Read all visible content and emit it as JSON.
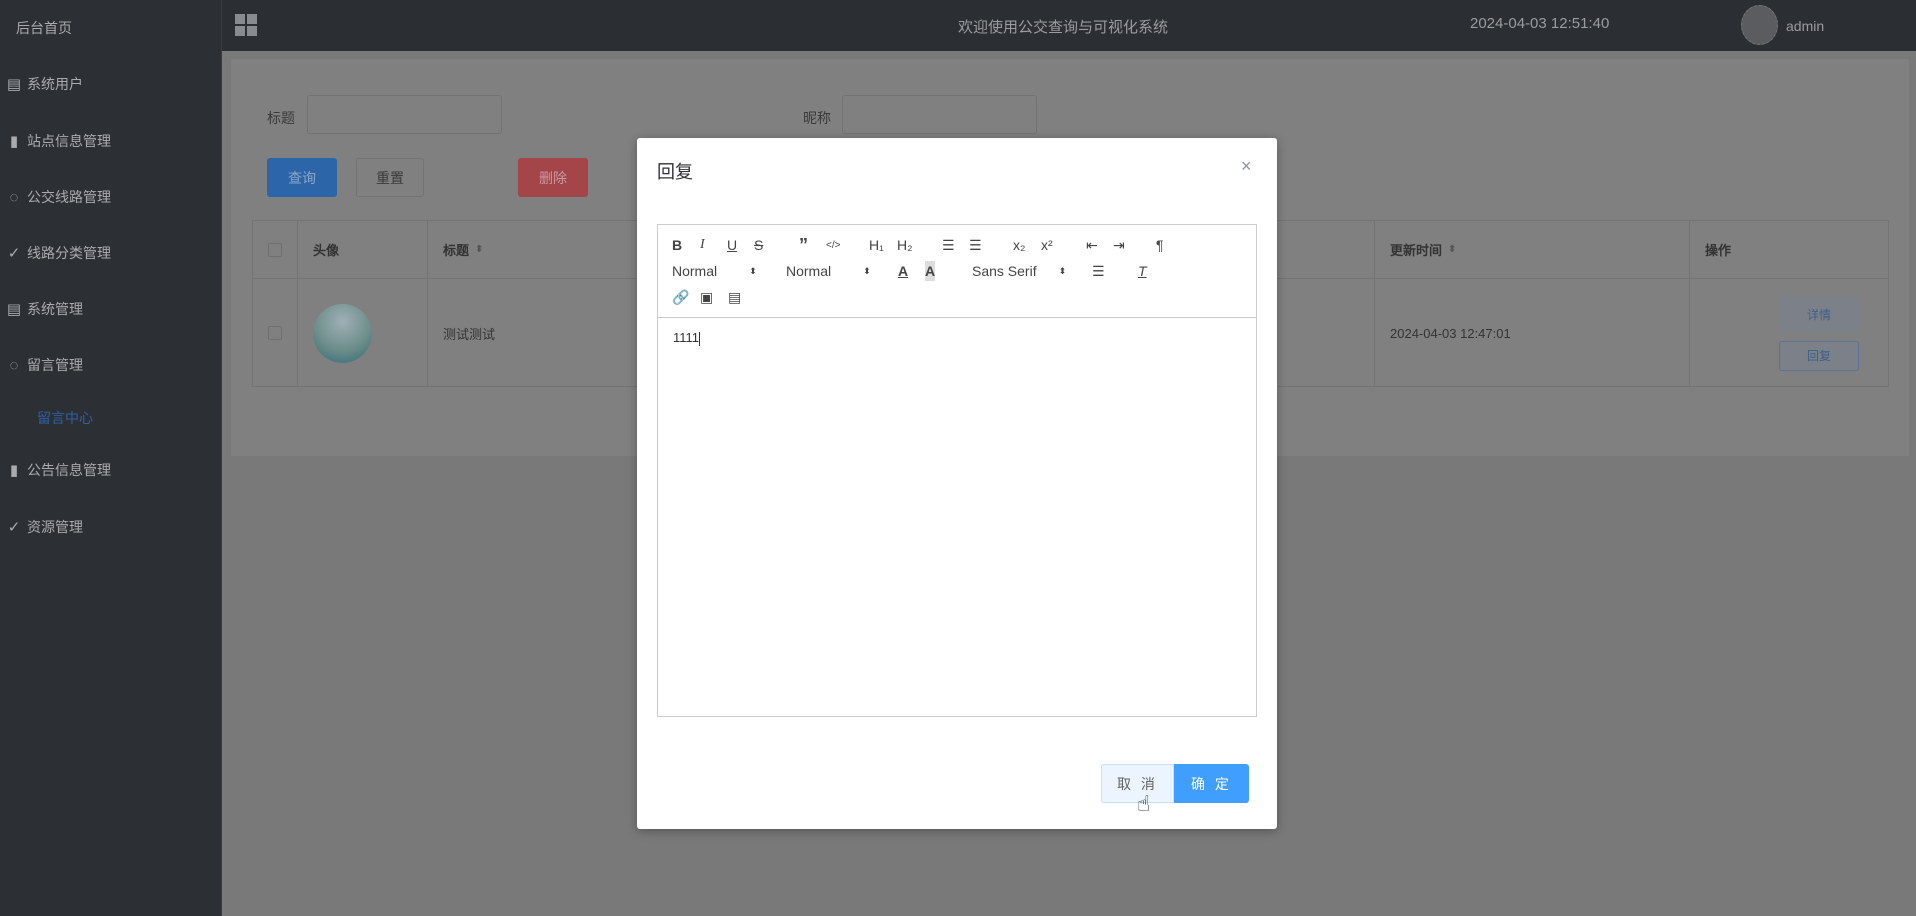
{
  "sidebar": {
    "home": "后台首页",
    "items": [
      {
        "label": "系统用户",
        "icon": "document-icon"
      },
      {
        "label": "站点信息管理",
        "icon": "bar-chart-icon"
      },
      {
        "label": "公交线路管理",
        "icon": "chat-icon"
      },
      {
        "label": "线路分类管理",
        "icon": "check-circle-icon"
      },
      {
        "label": "系统管理",
        "icon": "document-icon"
      },
      {
        "label": "留言管理",
        "icon": "chat-icon"
      },
      {
        "label": "公告信息管理",
        "icon": "bar-chart-icon"
      },
      {
        "label": "资源管理",
        "icon": "check-circle-icon"
      }
    ],
    "sub_item": "留言中心"
  },
  "header": {
    "title": "欢迎使用公交查询与可视化系统",
    "datetime": "2024-04-03 12:51:40",
    "user": "admin"
  },
  "search": {
    "title_label": "标题",
    "nickname_label": "昵称",
    "title_value": "",
    "nickname_value": "",
    "query": "查询",
    "reset": "重置",
    "delete": "删除"
  },
  "table": {
    "columns": [
      "头像",
      "标题",
      "更新时间",
      "操作"
    ],
    "rows": [
      {
        "title": "测试测试",
        "updated": "2024-04-03 12:47:01",
        "detail": "详情",
        "reply": "回复"
      }
    ]
  },
  "modal": {
    "title": "回复",
    "close": "×",
    "editor": {
      "header_select": "Normal",
      "size_select": "Normal",
      "font_select": "Sans Serif",
      "content": "1111"
    },
    "cancel": "取 消",
    "confirm": "确 定"
  }
}
